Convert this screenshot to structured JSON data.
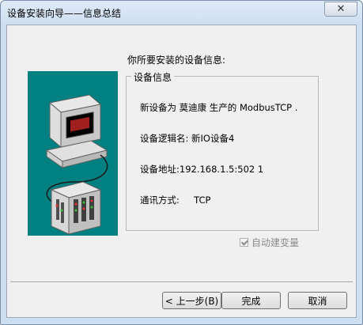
{
  "window": {
    "title": "设备安装向导——信息总结",
    "close_glyph": "✕"
  },
  "main": {
    "heading": "你所要安装的设备信息:",
    "group_title": "设备信息",
    "lines": [
      "新设备为 莫迪康 生产的 ModbusTCP .",
      "设备逻辑名: 新IO设备4",
      "设备地址:192.168.1.5:502 1",
      "通讯方式:     TCP"
    ],
    "auto_variable_label": "自动建变量",
    "auto_variable_checked": true
  },
  "buttons": {
    "back": "< 上一步(B)",
    "finish": "完成",
    "cancel": "取消"
  },
  "colors": {
    "illustration_bg": "#008080"
  },
  "icons": {
    "illustration": "computer-and-io-device-icon",
    "close": "close-icon"
  }
}
